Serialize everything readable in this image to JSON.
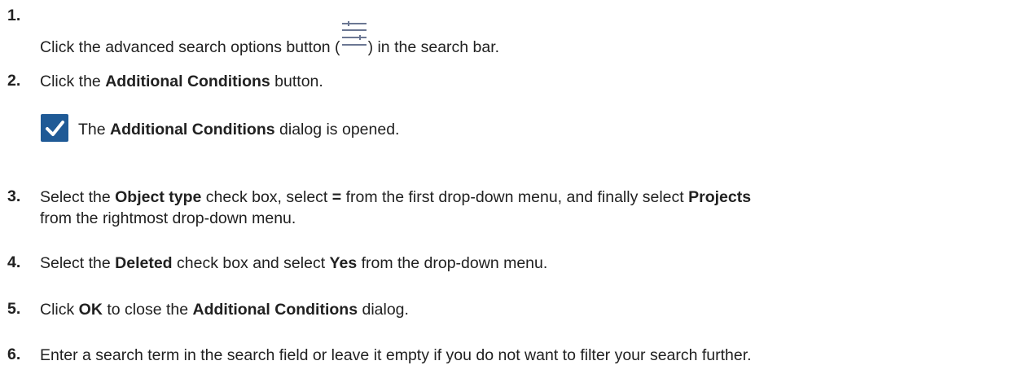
{
  "steps": [
    {
      "number": "1.",
      "text_before": "Click the advanced search options button (",
      "icon": "advanced-search-options-icon",
      "text_after": ") in the search bar."
    },
    {
      "number": "2.",
      "t1": "Click the ",
      "b1": "Additional Conditions",
      "t2": " button."
    },
    {
      "number": "3.",
      "t1": "Select the ",
      "b1": "Object type",
      "t2": " check box, select ",
      "b2": "=",
      "t3": " from the first drop-down menu, and finally select ",
      "b3": "Projects",
      "line2": "from the rightmost drop-down menu."
    },
    {
      "number": "4.",
      "t1": "Select the ",
      "b1": "Deleted",
      "t2": " check box and select ",
      "b2": "Yes",
      "t3": " from the drop-down menu."
    },
    {
      "number": "5.",
      "t1": "Click ",
      "b1": "OK",
      "t2": " to close the ",
      "b2": "Additional Conditions",
      "t3": " dialog."
    },
    {
      "number": "6.",
      "t1": "Enter a search term in the search field or leave it empty if you do not want to filter your search further."
    }
  ],
  "result": {
    "icon": "checkmark-icon",
    "t1": "The ",
    "b1": "Additional Conditions",
    "t2": " dialog is opened."
  },
  "colors": {
    "text": "#212121",
    "icon_gray": "#6b7793",
    "check_blue": "#1f5a96"
  }
}
